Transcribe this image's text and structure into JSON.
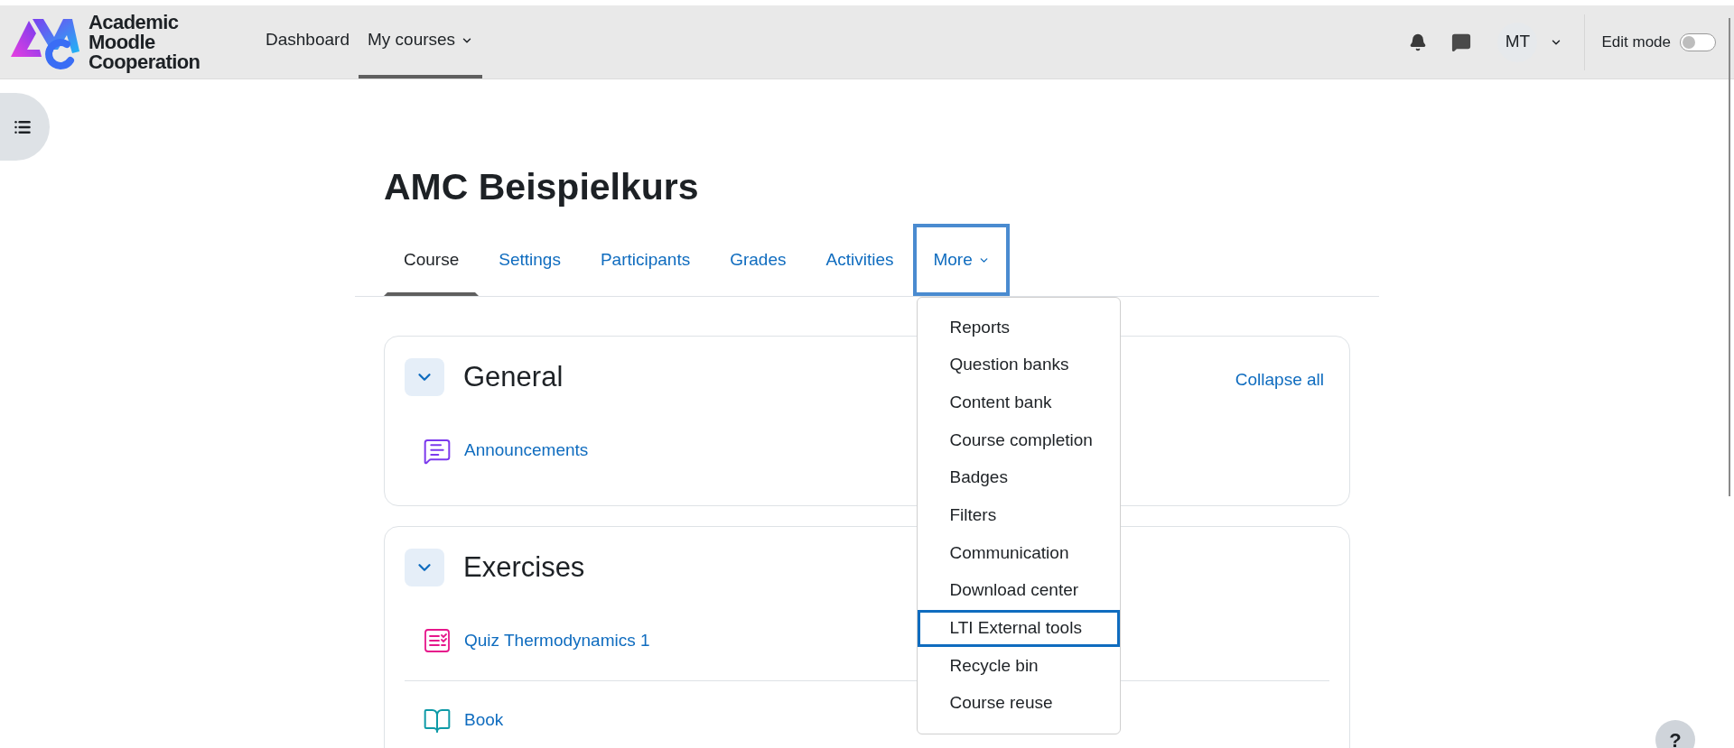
{
  "header": {
    "logo_lines": [
      "Academic",
      "Moodle",
      "Cooperation"
    ],
    "nav": [
      {
        "label": "Dashboard",
        "selected": false,
        "has_caret": false
      },
      {
        "label": "My courses",
        "selected": true,
        "has_caret": true
      }
    ],
    "user_initials": "MT",
    "edit_mode": {
      "label": "Edit mode",
      "on": false
    }
  },
  "course": {
    "title": "AMC Beispielkurs",
    "tabs": [
      {
        "label": "Course",
        "selected": true,
        "focused": false,
        "has_caret": false
      },
      {
        "label": "Settings",
        "selected": false,
        "focused": false,
        "has_caret": false
      },
      {
        "label": "Participants",
        "selected": false,
        "focused": false,
        "has_caret": false
      },
      {
        "label": "Grades",
        "selected": false,
        "focused": false,
        "has_caret": false
      },
      {
        "label": "Activities",
        "selected": false,
        "focused": false,
        "has_caret": false
      },
      {
        "label": "More",
        "selected": false,
        "focused": true,
        "has_caret": true
      }
    ],
    "more_menu": [
      {
        "label": "Reports",
        "focused": false
      },
      {
        "label": "Question banks",
        "focused": false
      },
      {
        "label": "Content bank",
        "focused": false
      },
      {
        "label": "Course completion",
        "focused": false
      },
      {
        "label": "Badges",
        "focused": false
      },
      {
        "label": "Filters",
        "focused": false
      },
      {
        "label": "Communication",
        "focused": false
      },
      {
        "label": "Download center",
        "focused": false
      },
      {
        "label": "LTI External tools",
        "focused": true
      },
      {
        "label": "Recycle bin",
        "focused": false
      },
      {
        "label": "Course reuse",
        "focused": false
      }
    ],
    "collapse_all": "Collapse all",
    "sections": [
      {
        "title": "General",
        "expanded": true,
        "activities": [
          {
            "kind": "forum",
            "title": "Announcements"
          }
        ]
      },
      {
        "title": "Exercises",
        "expanded": true,
        "activities": [
          {
            "kind": "quiz",
            "title": "Quiz Thermodynamics 1"
          },
          {
            "kind": "book",
            "title": "Book"
          }
        ]
      }
    ]
  },
  "help": "?"
}
